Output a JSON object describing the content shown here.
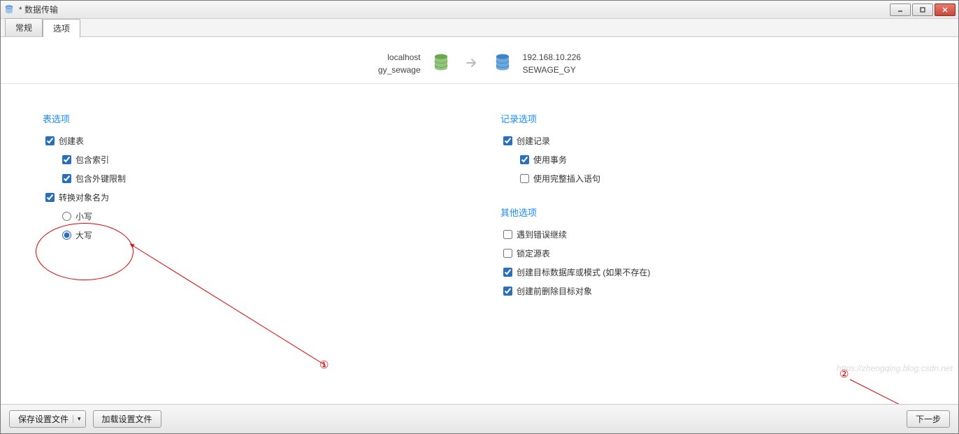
{
  "window": {
    "title": "* 数据传输"
  },
  "tabs": {
    "general": "常规",
    "options": "选项"
  },
  "transfer": {
    "source": {
      "host": "localhost",
      "db": "gy_sewage"
    },
    "target": {
      "host": "192.168.10.226",
      "db": "SEWAGE_GY"
    }
  },
  "table_options": {
    "heading": "表选项",
    "create_table": "创建表",
    "include_index": "包含索引",
    "include_fk": "包含外键限制",
    "convert_names": "转换对象名为",
    "lowercase": "小写",
    "uppercase": "大写"
  },
  "record_options": {
    "heading": "记录选项",
    "create_records": "创建记录",
    "use_transaction": "使用事务",
    "full_insert": "使用完整插入语句"
  },
  "other_options": {
    "heading": "其他选项",
    "continue_on_error": "遇到错误继续",
    "lock_source": "锁定源表",
    "create_target_schema": "创建目标数据库或模式 (如果不存在)",
    "drop_target_first": "创建前删除目标对象"
  },
  "footer": {
    "save_profile": "保存设置文件",
    "load_profile": "加载设置文件",
    "next": "下一步"
  },
  "annotations": {
    "mark1": "①",
    "mark2": "②"
  },
  "watermark": "https://zhengqing.blog.csdn.net"
}
